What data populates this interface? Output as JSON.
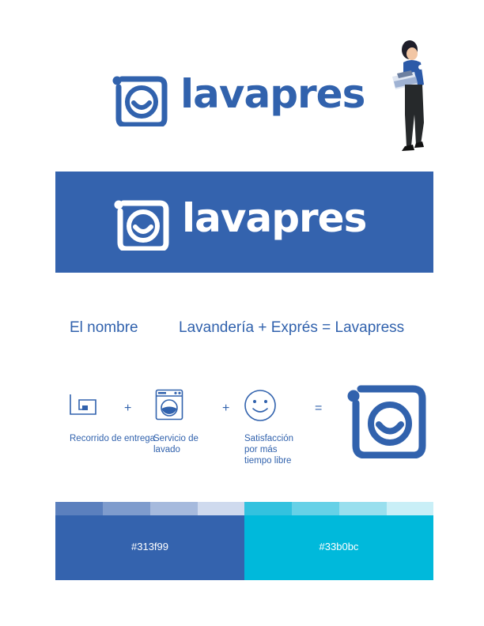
{
  "brand": {
    "name": "lavapres",
    "colors": {
      "primary": "#3162ad",
      "secondary": "#33b0bc",
      "white": "#ffffff"
    }
  },
  "concept": {
    "label": "El nombre",
    "formula": "Lavandería + Exprés = Lavapress"
  },
  "icons": [
    {
      "icon": "delivery-route-icon",
      "label": "Recorrido de entrega"
    },
    {
      "icon": "washing-machine-icon",
      "label": "Servicio de lavado"
    },
    {
      "icon": "smiley-icon",
      "label": "Satisfacción por más tiempo libre"
    }
  ],
  "operators": {
    "plus": "+",
    "equals": "="
  },
  "palette": {
    "primary_hex": "#313f99",
    "secondary_hex": "#33b0bc",
    "primary_tints": [
      "#5b80be",
      "#7f9ccd",
      "#a6badd",
      "#cfdaee"
    ],
    "secondary_tints": [
      "#33c2df",
      "#66d1e7",
      "#99dfee",
      "#c9eff7"
    ],
    "primary_fill": "#3463ae",
    "secondary_fill": "#00b9db"
  }
}
